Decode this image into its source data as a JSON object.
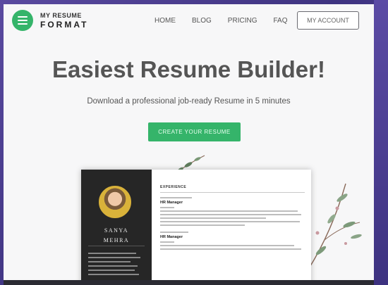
{
  "logo": {
    "line1": "MY RESUME",
    "line2": "FORMAT"
  },
  "nav": {
    "items": [
      "HOME",
      "BLOG",
      "PRICING",
      "FAQ"
    ],
    "account": "MY ACCOUNT"
  },
  "hero": {
    "title": "Easiest Resume Builder!",
    "subtitle": "Download a professional job-ready Resume in 5 minutes",
    "cta": "CREATE YOUR RESUME"
  },
  "resume": {
    "name_first": "SANYA",
    "name_last": "MEHRA",
    "section": "EXPERIENCE",
    "jobs": [
      "HR Manager",
      "HR Manager"
    ]
  },
  "colors": {
    "brand_green": "#35b46a",
    "dark_panel": "#262626",
    "frame_purple": "#4b3f8c"
  }
}
